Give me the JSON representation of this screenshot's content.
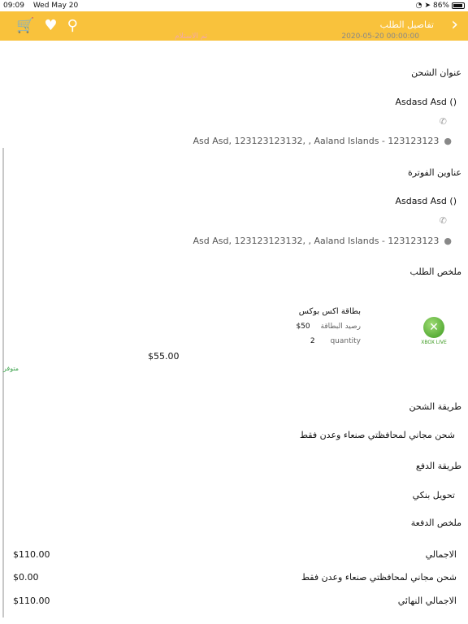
{
  "status_bar": {
    "time": "09:09",
    "date": "Wed May 20",
    "battery": "86%"
  },
  "nav": {
    "title": "تفاصيل الطلب"
  },
  "clipped": {
    "date_partial": "2020-05-20 00:00:00",
    "status_partial": "تم الاستلام"
  },
  "shipping_address": {
    "heading": "عنوان الشحن",
    "name": "Asdasd Asd ()",
    "address": "Asd Asd, 123123123132, , Aaland Islands - 123123123"
  },
  "billing_address": {
    "heading": "عناوين الفوترة",
    "name": "Asdasd Asd ()",
    "address": "Asd Asd, 123123123132, , Aaland Islands - 123123123"
  },
  "order_summary": {
    "heading": "ملخص الطلب",
    "product": {
      "title": "بطاقة اكس بوكس",
      "balance_label": "رصيد البطاقة",
      "balance_value": "50$",
      "quantity_label": "quantity",
      "quantity_value": "2",
      "price": "$55.00",
      "stock": "متوفر",
      "logo_caption": "XBOX LIVE"
    }
  },
  "shipping_method": {
    "heading": "طريقة الشحن",
    "value": "شحن مجاني لمحافظتي صنعاء وعدن فقط"
  },
  "payment_method": {
    "heading": "طريقة الدفع",
    "value": "تحويل بنكي"
  },
  "payment_summary": {
    "heading": "ملخص الدفعة",
    "rows": [
      {
        "label": "الاجمالي",
        "value": "$110.00"
      },
      {
        "label": "شحن مجاني لمحافظتي صنعاء وعدن فقط",
        "value": "$0.00"
      },
      {
        "label": "الاجمالي النهائي",
        "value": "$110.00"
      }
    ]
  },
  "colors": {
    "accent": "#f9c23c",
    "stock": "#3aa14a"
  }
}
